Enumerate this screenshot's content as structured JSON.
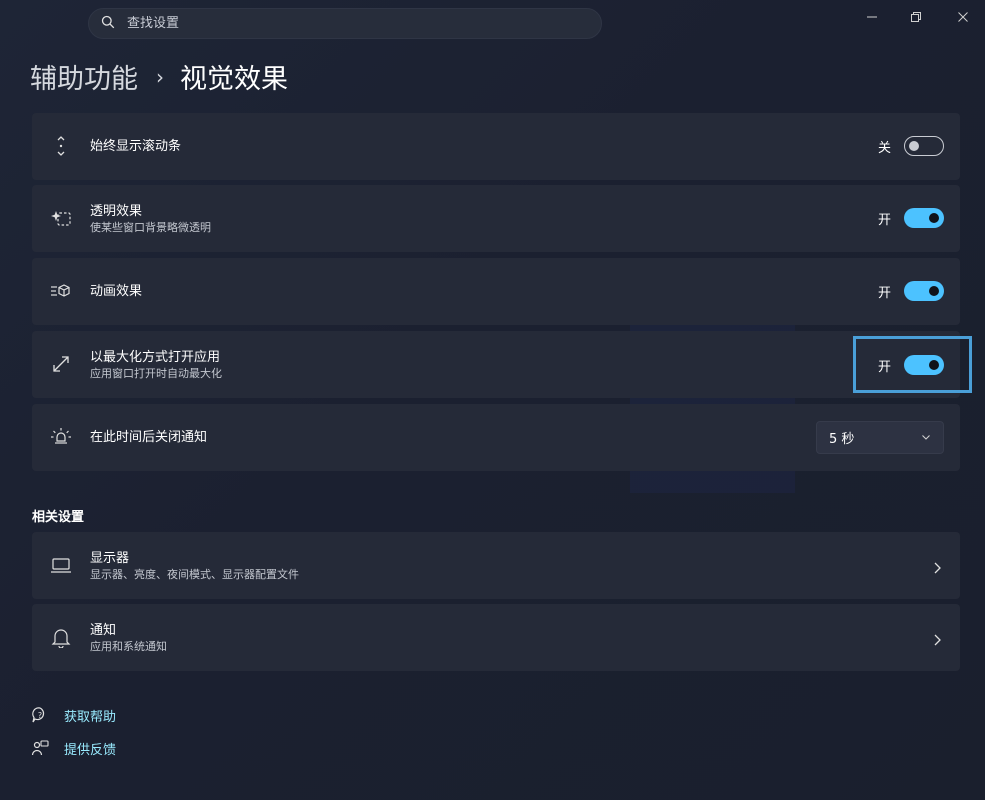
{
  "search": {
    "placeholder": "查找设置"
  },
  "breadcrumb": {
    "parent": "辅助功能",
    "separator": "›",
    "current": "视觉效果"
  },
  "settings": [
    {
      "title": "始终显示滚动条",
      "desc": "",
      "state_label": "关",
      "on": false,
      "icon": "scrollbar-icon"
    },
    {
      "title": "透明效果",
      "desc": "使某些窗口背景略微透明",
      "state_label": "开",
      "on": true,
      "icon": "transparency-icon"
    },
    {
      "title": "动画效果",
      "desc": "",
      "state_label": "开",
      "on": true,
      "icon": "animation-icon"
    },
    {
      "title": "以最大化方式打开应用",
      "desc": "应用窗口打开时自动最大化",
      "state_label": "开",
      "on": true,
      "icon": "maximize-icon"
    },
    {
      "title": "在此时间后关闭通知",
      "desc": "",
      "value": "5 秒",
      "icon": "notification-timer-icon"
    }
  ],
  "related": {
    "title": "相关设置",
    "items": [
      {
        "title": "显示器",
        "desc": "显示器、亮度、夜间模式、显示器配置文件",
        "icon": "display-icon"
      },
      {
        "title": "通知",
        "desc": "应用和系统通知",
        "icon": "bell-icon"
      }
    ]
  },
  "links": {
    "help": "获取帮助",
    "feedback": "提供反馈"
  },
  "colors": {
    "accent": "#4cc2ff",
    "card": "#252a38",
    "link": "#99ebff",
    "focus": "#4a9fd8"
  }
}
